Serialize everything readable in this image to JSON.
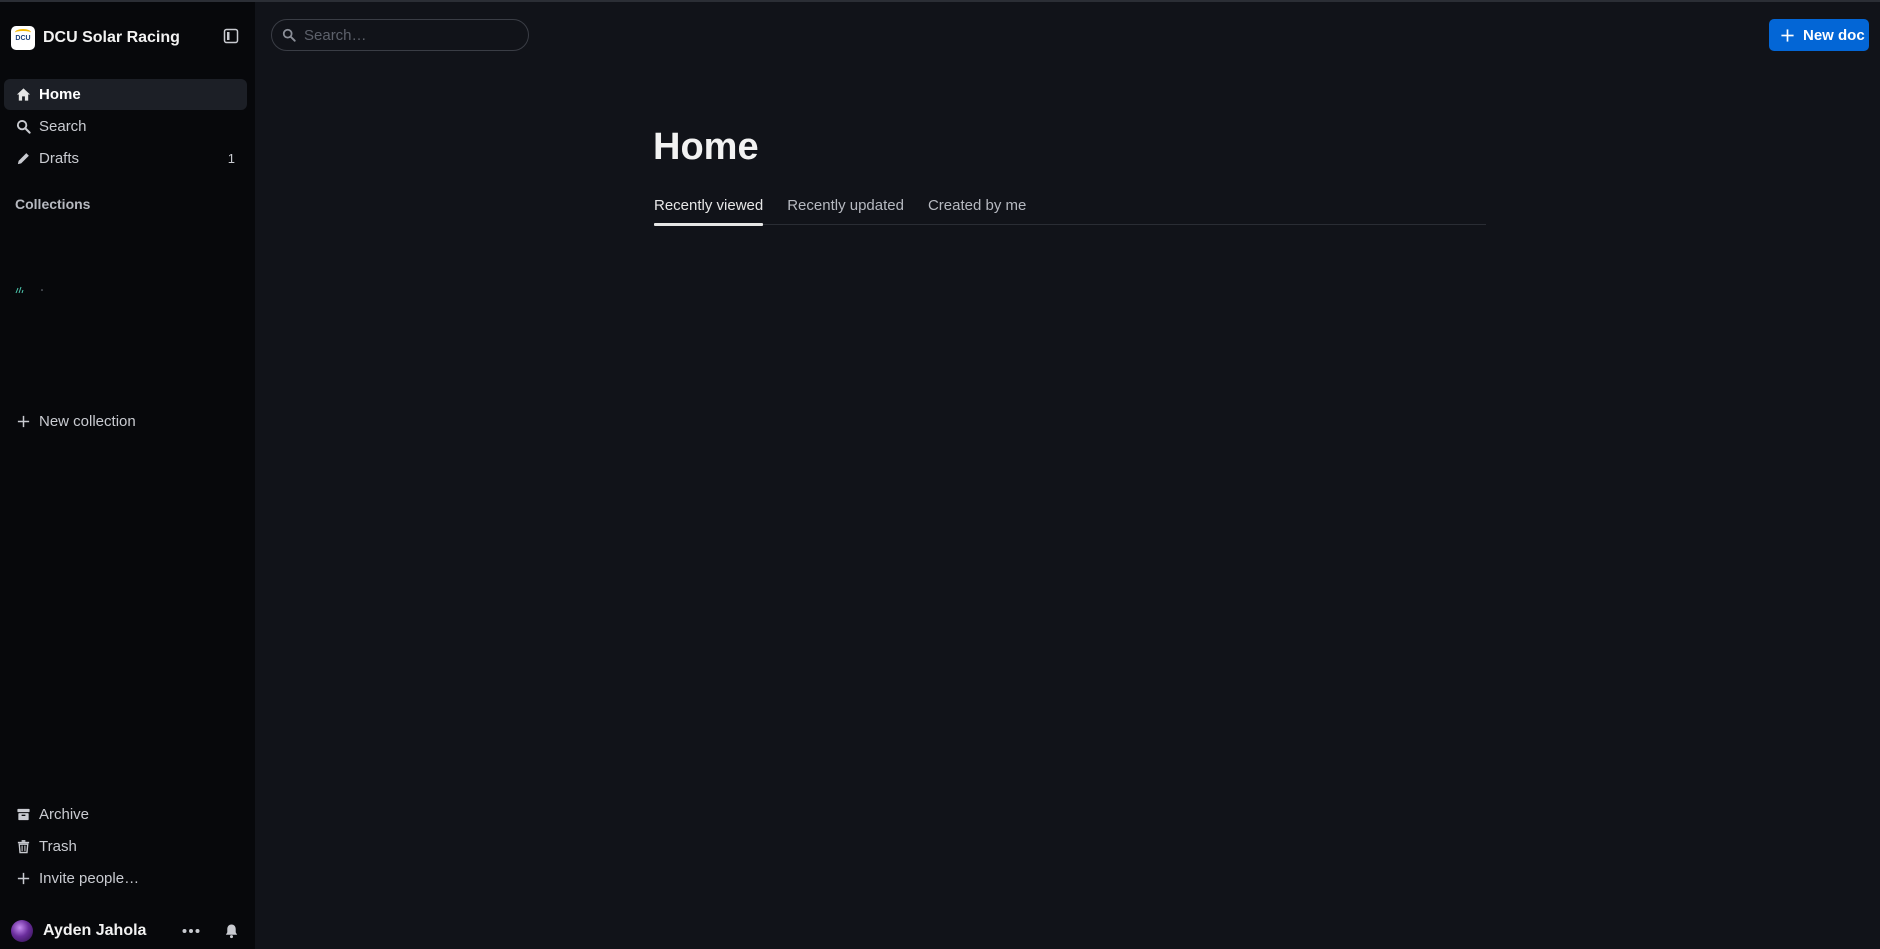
{
  "team": {
    "name": "DCU Solar Racing",
    "logo_text": "DCU"
  },
  "sidebar": {
    "nav": [
      {
        "label": "Home",
        "icon": "home-icon"
      },
      {
        "label": "Search",
        "icon": "search-icon"
      },
      {
        "label": "Drafts",
        "icon": "pencil-icon",
        "count": "1"
      }
    ],
    "collections_label": "Collections",
    "new_collection": "New collection",
    "bottom": [
      {
        "label": "Archive",
        "icon": "archive-icon"
      },
      {
        "label": "Trash",
        "icon": "trash-icon"
      },
      {
        "label": "Invite people…",
        "icon": "plus-icon"
      }
    ],
    "user": {
      "name": "Ayden Jahola"
    }
  },
  "header": {
    "search_placeholder": "Search…",
    "new_doc_label": "New doc"
  },
  "main": {
    "title": "Home",
    "tabs": [
      {
        "label": "Recently viewed",
        "active": true
      },
      {
        "label": "Recently updated",
        "active": false
      },
      {
        "label": "Created by me",
        "active": false
      }
    ]
  },
  "colors": {
    "background": "#111319",
    "sidebar": "#07080b",
    "accent": "#0366d6",
    "active_item": "#1c1f26"
  }
}
